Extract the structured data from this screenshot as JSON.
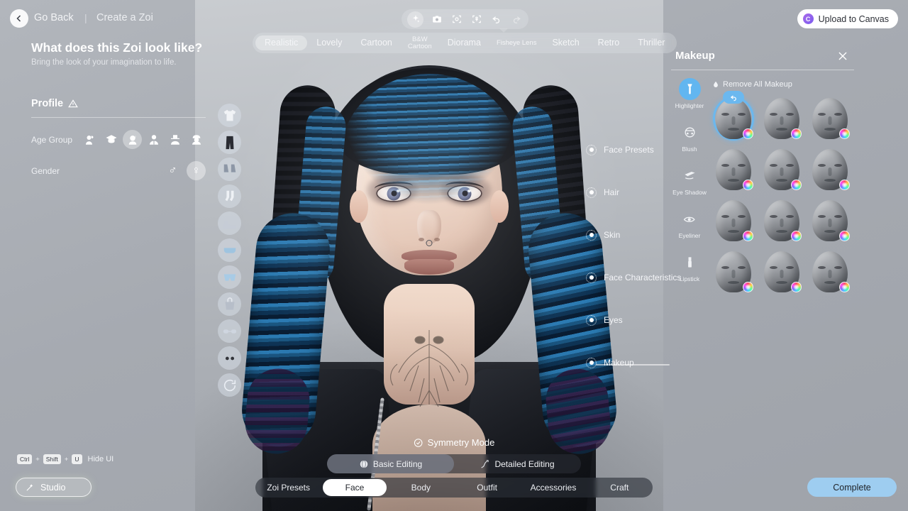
{
  "header": {
    "back_label": "Go Back",
    "divider": "|",
    "breadcrumb": "Create a Zoi",
    "upload_label": "Upload to Canvas",
    "canvas_logo_letter": "C",
    "tools": [
      {
        "name": "ai-sparkle-icon",
        "label": "AI Generate"
      },
      {
        "name": "camera-icon",
        "label": "Camera"
      },
      {
        "name": "face-framing-icon",
        "label": "Face Framing"
      },
      {
        "name": "body-framing-icon",
        "label": "Body Framing"
      },
      {
        "name": "undo-icon",
        "label": "Undo"
      },
      {
        "name": "redo-icon",
        "label": "Redo"
      }
    ]
  },
  "style_tabs": {
    "selected": "Realistic",
    "items": [
      {
        "label": "Realistic",
        "small": false
      },
      {
        "label": "Lovely",
        "small": false
      },
      {
        "label": "Cartoon",
        "small": false
      },
      {
        "label": "B&W Cartoon",
        "small": false
      },
      {
        "label": "Diorama",
        "small": false
      },
      {
        "label": "Fisheye Lens",
        "small": true
      },
      {
        "label": "Sketch",
        "small": false
      },
      {
        "label": "Retro",
        "small": false
      },
      {
        "label": "Thriller",
        "small": false
      }
    ]
  },
  "prompt": {
    "title": "What does this Zoi look like?",
    "subtitle": "Bring the look of your imagination to life."
  },
  "profile": {
    "title": "Profile",
    "warning_icon": "warning-triangle-icon",
    "age_group": {
      "label": "Age Group",
      "selected_index": 2,
      "options": [
        {
          "name": "infant",
          "icon": "baby-icon"
        },
        {
          "name": "child",
          "icon": "graduate-cap-icon"
        },
        {
          "name": "teen",
          "icon": "teen-icon"
        },
        {
          "name": "adult",
          "icon": "adult-icon"
        },
        {
          "name": "middle-aged",
          "icon": "hat-person-icon"
        },
        {
          "name": "elder",
          "icon": "elder-icon"
        }
      ]
    },
    "gender": {
      "label": "Gender",
      "selected": "female",
      "options": [
        {
          "name": "male",
          "glyph": "♂"
        },
        {
          "name": "female",
          "glyph": "♀"
        }
      ]
    }
  },
  "wardrobe": {
    "items": [
      {
        "name": "top-shirt",
        "icon": "tshirt-icon"
      },
      {
        "name": "bottom-pants",
        "icon": "pants-icon"
      },
      {
        "name": "shoes",
        "icon": "shoes-icon"
      },
      {
        "name": "socks",
        "icon": "socks-icon"
      },
      {
        "name": "sneakers",
        "icon": "sneakers-icon"
      },
      {
        "name": "bra",
        "icon": "bra-icon"
      },
      {
        "name": "underwear",
        "icon": "underwear-icon"
      },
      {
        "name": "accessories-bag",
        "icon": "bag-icon"
      },
      {
        "name": "glasses",
        "icon": "glasses-icon"
      },
      {
        "name": "earrings",
        "icon": "earrings-icon"
      },
      {
        "name": "reset-outfit",
        "icon": "reset-icon"
      }
    ]
  },
  "feature_menu": {
    "items": [
      {
        "label": "Face Presets"
      },
      {
        "label": "Hair"
      },
      {
        "label": "Skin"
      },
      {
        "label": "Face Characteristics"
      },
      {
        "label": "Eyes"
      },
      {
        "label": "Makeup"
      }
    ],
    "active": "Makeup"
  },
  "makeup_panel": {
    "title": "Makeup",
    "close_icon": "close-icon",
    "remove_all_label": "Remove All Makeup",
    "remove_all_icon": "droplet-icon",
    "categories": [
      {
        "label": "Highlighter",
        "icon": "highlighter-brush-icon",
        "active": true
      },
      {
        "label": "Blush",
        "icon": "blush-face-icon",
        "active": false
      },
      {
        "label": "Eye Shadow",
        "icon": "eyeshadow-brush-icon",
        "active": false
      },
      {
        "label": "Eyeliner",
        "icon": "eyeliner-icon",
        "active": false
      },
      {
        "label": "Lipstick",
        "icon": "lipstick-icon",
        "active": false
      }
    ],
    "selected_index": 0,
    "thumbnails": [
      {
        "id": "none",
        "has_undo_badge": true,
        "has_color_wheel": true
      },
      {
        "id": "preset-01",
        "has_undo_badge": false,
        "has_color_wheel": true
      },
      {
        "id": "preset-02",
        "has_undo_badge": false,
        "has_color_wheel": true
      },
      {
        "id": "preset-03",
        "has_undo_badge": false,
        "has_color_wheel": true
      },
      {
        "id": "preset-04",
        "has_undo_badge": false,
        "has_color_wheel": true
      },
      {
        "id": "preset-05",
        "has_undo_badge": false,
        "has_color_wheel": true
      },
      {
        "id": "preset-06",
        "has_undo_badge": false,
        "has_color_wheel": true
      },
      {
        "id": "preset-07",
        "has_undo_badge": false,
        "has_color_wheel": true
      },
      {
        "id": "preset-08",
        "has_undo_badge": false,
        "has_color_wheel": true
      },
      {
        "id": "preset-09",
        "has_undo_badge": false,
        "has_color_wheel": true
      },
      {
        "id": "preset-10",
        "has_undo_badge": false,
        "has_color_wheel": true
      },
      {
        "id": "preset-11",
        "has_undo_badge": false,
        "has_color_wheel": true
      }
    ]
  },
  "viewport_overlays": {
    "symmetry_label": "Symmetry Mode",
    "symmetry_icon": "symmetry-check-icon",
    "edit_modes": [
      {
        "label": "Basic Editing",
        "icon": "face-sphere-icon",
        "active": true
      },
      {
        "label": "Detailed Editing",
        "icon": "node-path-icon",
        "active": false
      }
    ]
  },
  "bottom_nav": {
    "active": "Face",
    "items": [
      {
        "label": "Zoi Presets"
      },
      {
        "label": "Face"
      },
      {
        "label": "Body"
      },
      {
        "label": "Outfit"
      },
      {
        "label": "Accessories"
      },
      {
        "label": "Craft"
      }
    ]
  },
  "footer": {
    "hide_ui": {
      "key1": "Ctrl",
      "plus1": "+",
      "key2": "Shift",
      "plus2": "+",
      "key3": "U",
      "label": "Hide UI"
    },
    "studio_label": "Studio",
    "studio_icon": "magic-wand-icon",
    "complete_label": "Complete"
  },
  "colors": {
    "accent_blue": "#6bb8ef",
    "complete_bg": "#9ecdf0",
    "canvas_purple": "#7b5cf0",
    "panel_bg": "#a9adb4"
  }
}
